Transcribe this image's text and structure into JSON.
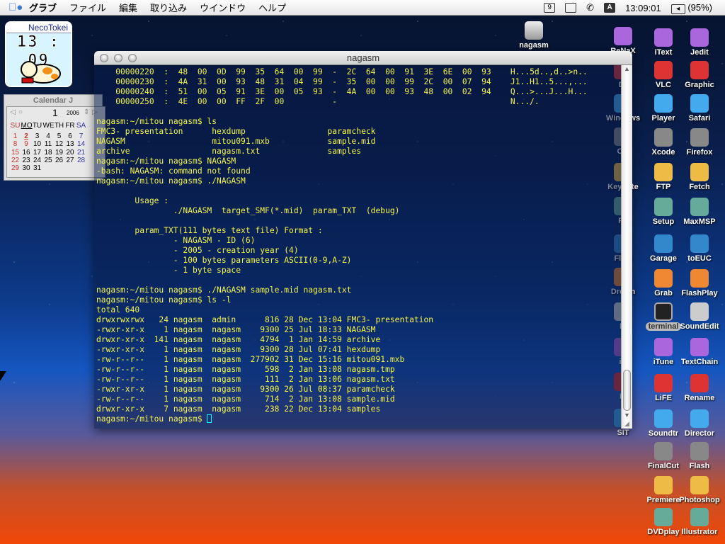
{
  "menubar": {
    "items": [
      "グラブ",
      "ファイル",
      "編集",
      "取り込み",
      "ウインドウ",
      "ヘルプ"
    ],
    "clock": "13:09:01",
    "battery": "(95%)",
    "input_method": "A"
  },
  "neco": {
    "title": "NecoTokei",
    "time": "13 : 09"
  },
  "calendar": {
    "title": "Calendar J",
    "month": "1",
    "year": "2006",
    "weekdays": [
      "SU",
      "MO",
      "TU",
      "WE",
      "TH",
      "FR",
      "SA"
    ],
    "weeks": [
      [
        "1",
        "2",
        "3",
        "4",
        "5",
        "6",
        "7"
      ],
      [
        "8",
        "9",
        "10",
        "11",
        "12",
        "13",
        "14"
      ],
      [
        "15",
        "16",
        "17",
        "18",
        "19",
        "20",
        "21"
      ],
      [
        "22",
        "23",
        "24",
        "25",
        "26",
        "27",
        "28"
      ],
      [
        "29",
        "30",
        "31",
        "",
        "",
        "",
        ""
      ]
    ]
  },
  "disk": {
    "label": "nagasm"
  },
  "terminal": {
    "title": "nagasm",
    "lines": [
      "    00000220  :  48  00  0D  99  35  64  00  99  -  2C  64  00  91  3E  6E  00  93    H...5d..,d..>n..",
      "    00000230  :  4A  31  00  93  48  31  04  99  -  35  00  00  99  2C  00  07  94    J1..H1..5...,...",
      "    00000240  :  51  00  05  91  3E  00  05  93  -  4A  00  00  93  48  00  02  94    Q...>...J...H...",
      "    00000250  :  4E  00  00  FF  2F  00          -                                    N.../.",
      "",
      "nagasm:~/mitou nagasm$ ls",
      "FMC3- presentation      hexdump                 paramcheck",
      "NAGASM                  mitou091.mxb            sample.mid",
      "archive                 nagasm.txt              samples",
      "nagasm:~/mitou nagasm$ NAGASM",
      "-bash: NAGASM: command not found",
      "nagasm:~/mitou nagasm$ ./NAGASM",
      "",
      "        Usage :",
      "                ./NAGASM  target_SMF(*.mid)  param_TXT  (debug)",
      "",
      "        param_TXT(111 bytes text file) Format :",
      "                - NAGASM - ID (6)",
      "                - 2005 - creation year (4)",
      "                - 100 bytes parameters ASCII(0-9,A-Z)",
      "                - 1 byte space",
      "",
      "nagasm:~/mitou nagasm$ ./NAGASM sample.mid nagasm.txt",
      "nagasm:~/mitou nagasm$ ls -l",
      "total 640",
      "drwxrwxrwx   24 nagasm  admin      816 28 Dec 13:04 FMC3- presentation",
      "-rwxr-xr-x    1 nagasm  nagasm    9300 25 Jul 18:33 NAGASM",
      "drwxr-xr-x  141 nagasm  nagasm    4794  1 Jan 14:59 archive",
      "-rwxr-xr-x    1 nagasm  nagasm    9300 28 Jul 07:41 hexdump",
      "-rw-r--r--    1 nagasm  nagasm  277902 31 Dec 15:16 mitou091.mxb",
      "-rw-r--r--    1 nagasm  nagasm     598  2 Jan 13:08 nagasm.tmp",
      "-rw-r--r--    1 nagasm  nagasm     111  2 Jan 13:06 nagasm.txt",
      "-rwxr-xr-x    1 nagasm  nagasm    9300 26 Jul 08:37 paramcheck",
      "-rw-r--r--    1 nagasm  nagasm     714  2 Jan 13:08 sample.mid",
      "drwxr-xr-x    7 nagasm  nagasm     238 22 Dec 13:04 samples"
    ],
    "prompt": "nagasm:~/mitou nagasm$ "
  },
  "icons": {
    "left": [
      "ReNaX",
      "Dr",
      "Windows",
      "Cla",
      "Keynote",
      "Pa",
      "Fla 8",
      "Dream",
      "Fi",
      "iD",
      "Li",
      "SIT"
    ],
    "colA": [
      "iText",
      "VLC",
      "Player",
      "Xcode",
      "FTP",
      "Setup",
      "Garage",
      "Grab",
      "terminal",
      "iTune",
      "LiFE",
      "Soundtr",
      "FinalCut",
      "Premiere",
      "DVDplay"
    ],
    "colB": [
      "Jedit",
      "Graphic",
      "Safari",
      "Firefox",
      "Fetch",
      "MaxMSP",
      "toEUC",
      "FlashPlay",
      "SoundEdit",
      "TextChain",
      "Rename",
      "Director",
      "Flash",
      "Photoshop",
      "Illustrator"
    ]
  },
  "colors": {
    "terminal_text": "#f4f44a",
    "accent": "#3a7bd5"
  }
}
